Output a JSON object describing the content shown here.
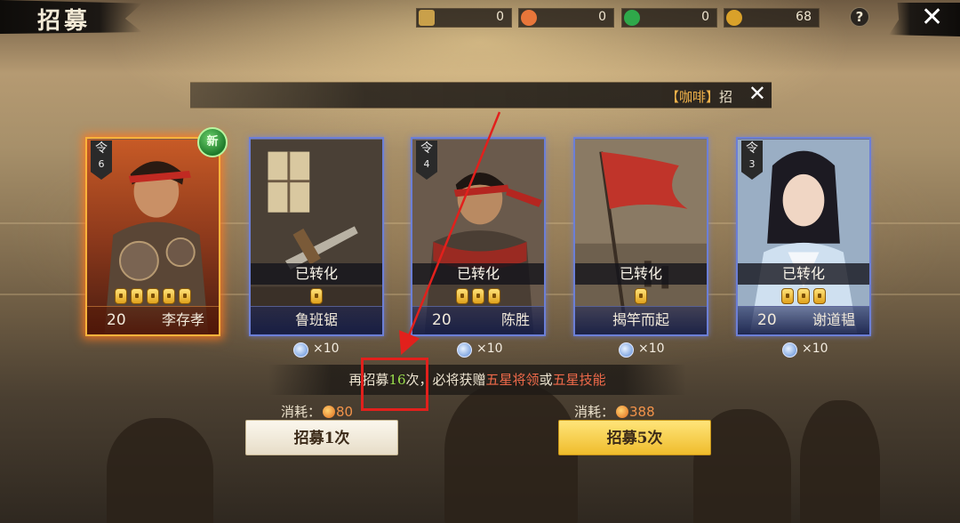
{
  "title": "招募",
  "currencies": [
    {
      "icon": "token-scroll-icon",
      "value": "0",
      "color": "#c9a04a"
    },
    {
      "icon": "jade-orange-icon",
      "value": "0",
      "color": "#e8763a"
    },
    {
      "icon": "jade-green-icon",
      "value": "0",
      "color": "#2fa84a"
    },
    {
      "icon": "gold-coin-icon",
      "value": "68",
      "color": "#d9a12a"
    }
  ],
  "help_label": "?",
  "close_label": "✕",
  "marquee": {
    "text_highlight": "【咖啡】",
    "text_tail": "招",
    "close_label": "✕"
  },
  "cards": [
    {
      "token_label": "令",
      "token_num": "6",
      "level": "20",
      "name": "李存孝",
      "converted": "",
      "stars": 5,
      "reward": "×10"
    },
    {
      "token_label": "",
      "token_num": "",
      "level": "",
      "name": "鲁班锯",
      "converted": "已转化",
      "stars": 1,
      "reward": "×10"
    },
    {
      "token_label": "令",
      "token_num": "4",
      "level": "20",
      "name": "陈胜",
      "converted": "已转化",
      "stars": 3,
      "reward": "×10"
    },
    {
      "token_label": "",
      "token_num": "",
      "level": "",
      "name": "揭竿而起",
      "converted": "已转化",
      "stars": 1,
      "reward": "×10"
    },
    {
      "token_label": "令",
      "token_num": "3",
      "level": "20",
      "name": "谢道韫",
      "converted": "已转化",
      "stars": 3,
      "reward": "×10"
    }
  ],
  "new_badge": "新",
  "notice": {
    "prefix": "再招募",
    "count": "16",
    "mid": "次，必将获赠",
    "reward1": "五星将领",
    "or": "或",
    "reward2": "五星技能"
  },
  "recruit_once": {
    "cost_label": "消耗：",
    "cost_value": "80",
    "button_label": "招募1次"
  },
  "recruit_five": {
    "cost_label": "消耗：",
    "cost_value": "388",
    "button_label": "招募5次"
  }
}
